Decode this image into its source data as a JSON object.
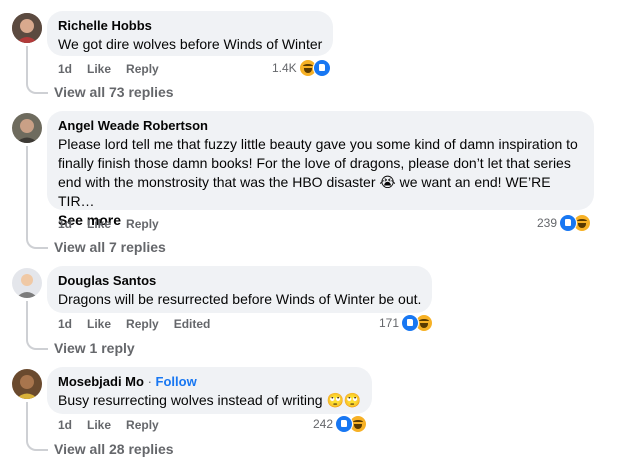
{
  "comments": [
    {
      "author": "Richelle Hobbs",
      "text": "We got dire wolves before Winds of Winter",
      "time": "1d",
      "like": "Like",
      "reply": "Reply",
      "reaction_count": "1.4K",
      "reactions": [
        "haha-icon",
        "like-icon"
      ],
      "view_replies": "View all 73 replies",
      "avatar_color": "#8a6a5a"
    },
    {
      "author": "Angel Weade Robertson",
      "text": "Please lord tell me that fuzzy little beauty gave you some kind of damn inspiration to finally finish those damn books! For the love of dragons, please don’t let that series end with the monstrosity that was the HBO disaster 😭 we want an end! WE’RE TIR…",
      "see_more": "See more",
      "time": "1d",
      "like": "Like",
      "reply": "Reply",
      "reaction_count": "239",
      "reactions": [
        "like-icon",
        "haha-icon"
      ],
      "view_replies": "View all 7 replies",
      "avatar_color": "#6b6b5a"
    },
    {
      "author": "Douglas Santos",
      "text": "Dragons will be resurrected before Winds of Winter be out.",
      "time": "1d",
      "like": "Like",
      "reply": "Reply",
      "edited": "Edited",
      "reaction_count": "171",
      "reactions": [
        "like-icon",
        "haha-icon"
      ],
      "view_replies": "View 1 reply",
      "avatar_color": "#d8d8d8"
    },
    {
      "author": "Mosebjadi Mo",
      "follow_sep": "·",
      "follow": "Follow",
      "text": "Busy resurrecting wolves instead of writing 🙄🙄",
      "time": "1d",
      "like": "Like",
      "reply": "Reply",
      "reaction_count": "242",
      "reactions": [
        "like-icon",
        "haha-icon"
      ],
      "view_replies": "View all 28 replies",
      "avatar_color": "#7a5a3a"
    }
  ]
}
